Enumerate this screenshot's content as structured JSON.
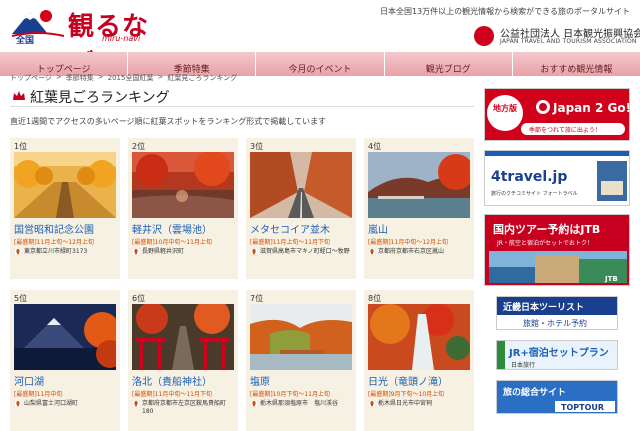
{
  "header": {
    "logo_text": "観るなび",
    "logo_badge": "全国",
    "logo_sub": "miru-navi",
    "tagline": "日本全国13万件以上の観光情報から検索ができる旅のポータルサイト",
    "org_name": "公益社団法人 日本観光振興協会",
    "org_name_en": "JAPAN TRAVEL AND TOURISM ASSOCIATION"
  },
  "nav": [
    "トップページ",
    "季節特集",
    "今月のイベント",
    "観光ブログ",
    "おすすめ観光情報"
  ],
  "breadcrumb": [
    "トップページ",
    ">",
    "季節特集",
    ">",
    "2015全国紅葉",
    ">",
    "紅葉見ごろランキング"
  ],
  "page": {
    "title": "紅葉見ごろランキング",
    "lead": "直近1週間でアクセスの多いページ順に紅葉スポットをランキング形式で掲載しています"
  },
  "cards": [
    {
      "rank": "1位",
      "name": "国営昭和記念公園",
      "period": "[最盛期]11月上旬〜12月上旬",
      "address": "東京都立川市緑町3173"
    },
    {
      "rank": "2位",
      "name": "軽井沢（雲場池）",
      "period": "[最盛期]10月中旬〜11月上旬",
      "address": "長野県軽井沢町"
    },
    {
      "rank": "3位",
      "name": "メタセコイア並木",
      "period": "[最盛期]11月上旬〜11月下旬",
      "address": "滋賀県高島市マキノ町蛭口〜牧野"
    },
    {
      "rank": "4位",
      "name": "嵐山",
      "period": "[最盛期]11月中旬〜12月上旬",
      "address": "京都府京都市右京区嵐山"
    },
    {
      "rank": "5位",
      "name": "河口湖",
      "period": "[最盛期]11月中旬",
      "address": "山梨県富士河口湖町"
    },
    {
      "rank": "6位",
      "name": "洛北（貴船神社）",
      "period": "[最盛期]11月中旬〜11月下旬",
      "address": "京都府京都市左京区鞍馬貴船町180"
    },
    {
      "rank": "7位",
      "name": "塩原",
      "period": "[最盛期]10月下旬〜11月上旬",
      "address": "栃木県那須塩原市　塩川渓谷"
    },
    {
      "rank": "8位",
      "name": "日光（竜頭ノ滝）",
      "period": "[最盛期]9月下旬〜10月上旬",
      "address": "栃木県日光市中宮祠"
    }
  ],
  "banners": {
    "b1_tag": "地方版",
    "b1_title": "Japan 2 Go!",
    "b1_sub": "季節をつれて旅に出よう！",
    "b2_title": "4travel.jp",
    "b2_sub": "旅行のクチコミサイト フォートラベル",
    "b3_title": "国内ツアー予約はJTB",
    "b3_sub": "JR・航空と宿泊がセットでおトク！",
    "b3_logo": "JTB",
    "b4_title": "近畿日本ツーリスト",
    "b4_sub": "旅館・ホテル予約",
    "b5_title": "JR+宿泊セットプラン",
    "b5_sub": "日本旅行",
    "b6_title": "旅の総合サイト",
    "b6_logo": "TOPTOUR"
  }
}
